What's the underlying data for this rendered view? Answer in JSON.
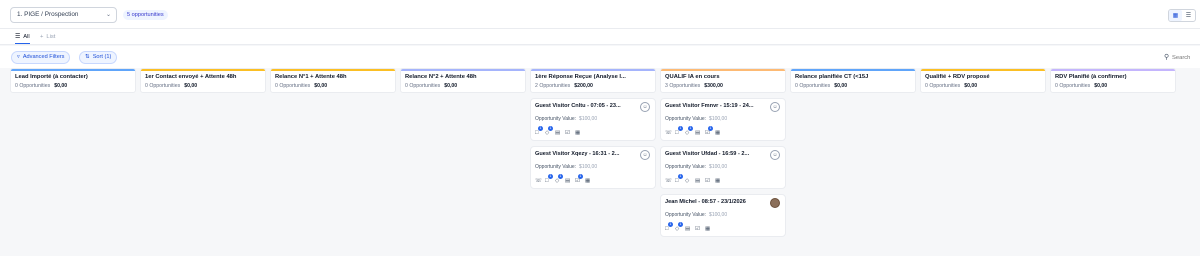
{
  "topbar": {
    "pipeline": "1. PIGE / Prospection",
    "count_badge": "5 opportunities"
  },
  "tabs": [
    {
      "label": "All",
      "active": true,
      "icon": "list-icon"
    },
    {
      "label": "List",
      "active": false,
      "icon": "plus-icon"
    }
  ],
  "filters": {
    "advanced": "Advanced Filters",
    "sort": "Sort (1)",
    "search_placeholder": "Search"
  },
  "colors": {
    "accent": "#2563eb",
    "bars": [
      "#60a5fa",
      "#fbbf24",
      "#fbbf24",
      "#a5b4fc",
      "#a5b4fc",
      "#fdba74",
      "#60a5fa",
      "#fbbf24",
      "#c4b5fd"
    ]
  },
  "columns": [
    {
      "title": "Lead Importé (à contacter)",
      "opportunities": "0 Opportunities",
      "amount": "$0,00",
      "cards": []
    },
    {
      "title": "1er Contact envoyé + Attente 48h",
      "opportunities": "0 Opportunities",
      "amount": "$0,00",
      "cards": []
    },
    {
      "title": "Relance N°1 + Attente 48h",
      "opportunities": "0 Opportunities",
      "amount": "$0,00",
      "cards": []
    },
    {
      "title": "Relance N°2 + Attente 48h",
      "opportunities": "0 Opportunities",
      "amount": "$0,00",
      "cards": []
    },
    {
      "title": "1ère Réponse Reçue (Analyse I...",
      "opportunities": "2 Opportunities",
      "amount": "$200,00",
      "cards": [
        {
          "title": "Guest Visitor Cnltu - 07:05 - 23...",
          "value_label": "Opportunity Value:",
          "value": "$100,00",
          "avatar": "user-icon"
        },
        {
          "title": "Guest Visitor Xqezy - 16:31 - 2...",
          "value_label": "Opportunity Value:",
          "value": "$100,00",
          "avatar": "user-icon"
        }
      ]
    },
    {
      "title": "QUALIF IA en cours",
      "opportunities": "3 Opportunities",
      "amount": "$300,00",
      "cards": [
        {
          "title": "Guest Visitor Fmnvr - 15:19 - 24...",
          "value_label": "Opportunity Value:",
          "value": "$100,00",
          "avatar": "user-icon"
        },
        {
          "title": "Guest Visitor Ufdad - 16:59 - 2...",
          "value_label": "Opportunity Value:",
          "value": "$100,00",
          "avatar": "user-icon"
        },
        {
          "title": "Jean Michel - 08:57 - 23/1/2026",
          "value_label": "Opportunity Value:",
          "value": "$100,00",
          "avatar": "photo"
        }
      ]
    },
    {
      "title": "Relance planifiée CT (<15J",
      "opportunities": "0 Opportunities",
      "amount": "$0,00",
      "cards": []
    },
    {
      "title": "Qualifié + RDV proposé",
      "opportunities": "0 Opportunities",
      "amount": "$0,00",
      "cards": []
    },
    {
      "title": "RDV Planifié (à confirmer)",
      "opportunities": "0 Opportunities",
      "amount": "$0,00",
      "cards": []
    }
  ]
}
